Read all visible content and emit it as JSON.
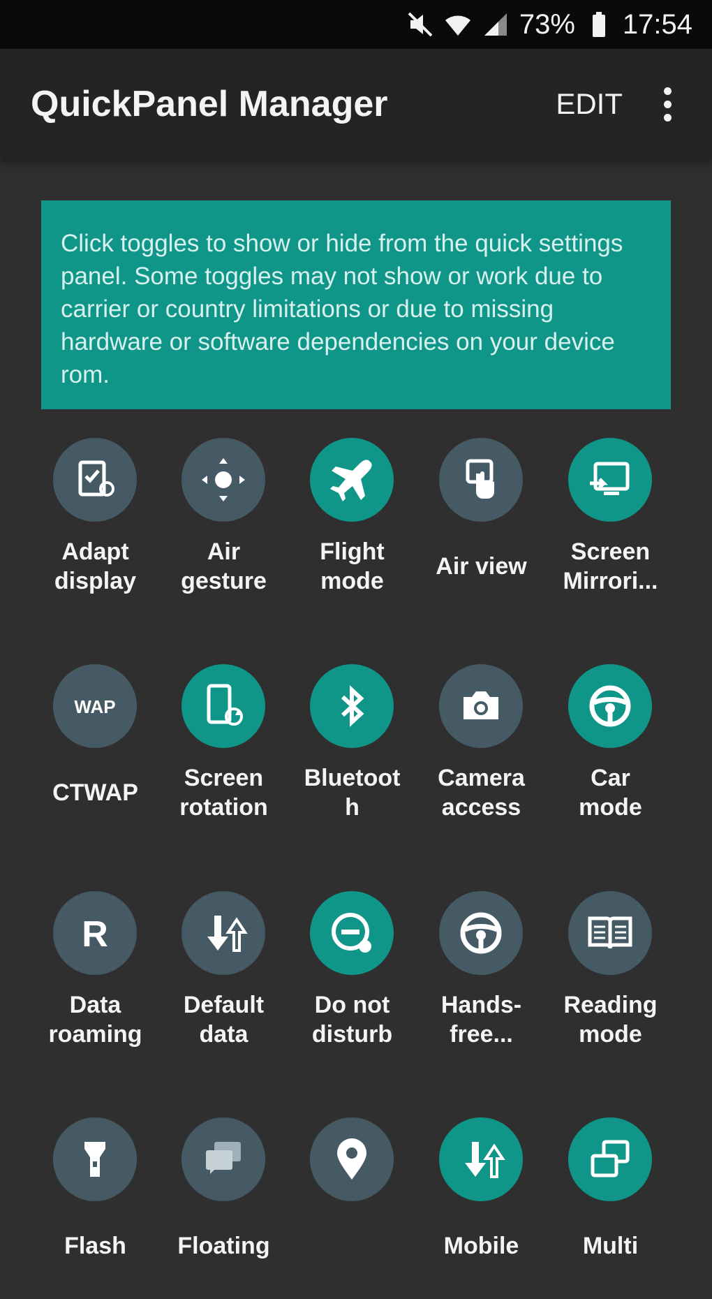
{
  "status_bar": {
    "battery": "73%",
    "time": "17:54",
    "icons": [
      "mute-icon",
      "wifi-icon",
      "signal-icon",
      "battery-icon"
    ]
  },
  "app_bar": {
    "title": "QuickPanel Manager",
    "edit_label": "EDIT",
    "more_icon": "more-vert-icon"
  },
  "banner": {
    "text": "Click toggles to show or hide from the quick settings panel. Some toggles may not show or work due to carrier or country limitations or due to missing hardware or software dependencies on your device rom."
  },
  "colors": {
    "accent": "#0f9688",
    "tile_off": "#455a64",
    "background": "#2f2f2f"
  },
  "tiles": [
    {
      "label": "Adapt\ndisplay",
      "icon": "adapt-display-icon",
      "on": false
    },
    {
      "label": "Air\ngesture",
      "icon": "air-gesture-icon",
      "on": false
    },
    {
      "label": "Flight\nmode",
      "icon": "airplane-icon",
      "on": true
    },
    {
      "label": "Air view",
      "icon": "air-view-icon",
      "on": false
    },
    {
      "label": "Screen\nMirrori...",
      "icon": "screen-mirroring-icon",
      "on": true
    },
    {
      "label": "CTWAP",
      "icon": "wap-icon",
      "on": false
    },
    {
      "label": "Screen\nrotation",
      "icon": "screen-rotation-icon",
      "on": true
    },
    {
      "label": "Bluetoot\nh",
      "icon": "bluetooth-icon",
      "on": true
    },
    {
      "label": "Camera\naccess",
      "icon": "camera-icon",
      "on": false
    },
    {
      "label": "Car\nmode",
      "icon": "steering-wheel-icon",
      "on": true
    },
    {
      "label": "Data\nroaming",
      "icon": "data-roaming-icon",
      "on": false
    },
    {
      "label": "Default\ndata",
      "icon": "default-data-icon",
      "on": false
    },
    {
      "label": "Do not\ndisturb",
      "icon": "do-not-disturb-icon",
      "on": true
    },
    {
      "label": "Hands-\nfree...",
      "icon": "steering-wheel-icon",
      "on": false
    },
    {
      "label": "Reading\nmode",
      "icon": "book-icon",
      "on": false
    },
    {
      "label": "Flash",
      "icon": "flashlight-icon",
      "on": false
    },
    {
      "label": "Floating",
      "icon": "floating-messages-icon",
      "on": false
    },
    {
      "label": "",
      "icon": "location-icon",
      "on": false
    },
    {
      "label": "Mobile",
      "icon": "mobile-data-icon",
      "on": true
    },
    {
      "label": "Multi",
      "icon": "multi-window-icon",
      "on": true
    }
  ]
}
